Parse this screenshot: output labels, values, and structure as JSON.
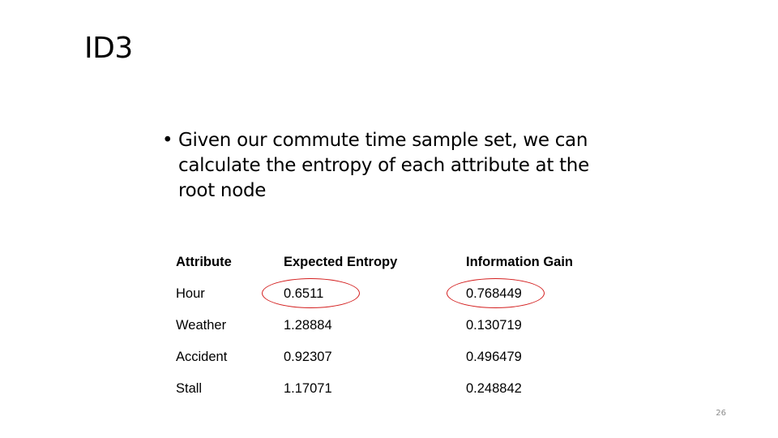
{
  "slide": {
    "title": "ID3",
    "bullets": [
      "Given our commute time sample set, we can calculate the entropy of each attribute at the root node"
    ],
    "table": {
      "headers": [
        "Attribute",
        "Expected Entropy",
        "Information Gain"
      ],
      "rows": [
        [
          "Hour",
          "0.6511",
          "0.768449"
        ],
        [
          "Weather",
          "1.28884",
          "0.130719"
        ],
        [
          "Accident",
          "0.92307",
          "0.496479"
        ],
        [
          "Stall",
          "1.17071",
          "0.248842"
        ]
      ]
    },
    "highlight_color": "#d42020",
    "slide_number": "26"
  }
}
